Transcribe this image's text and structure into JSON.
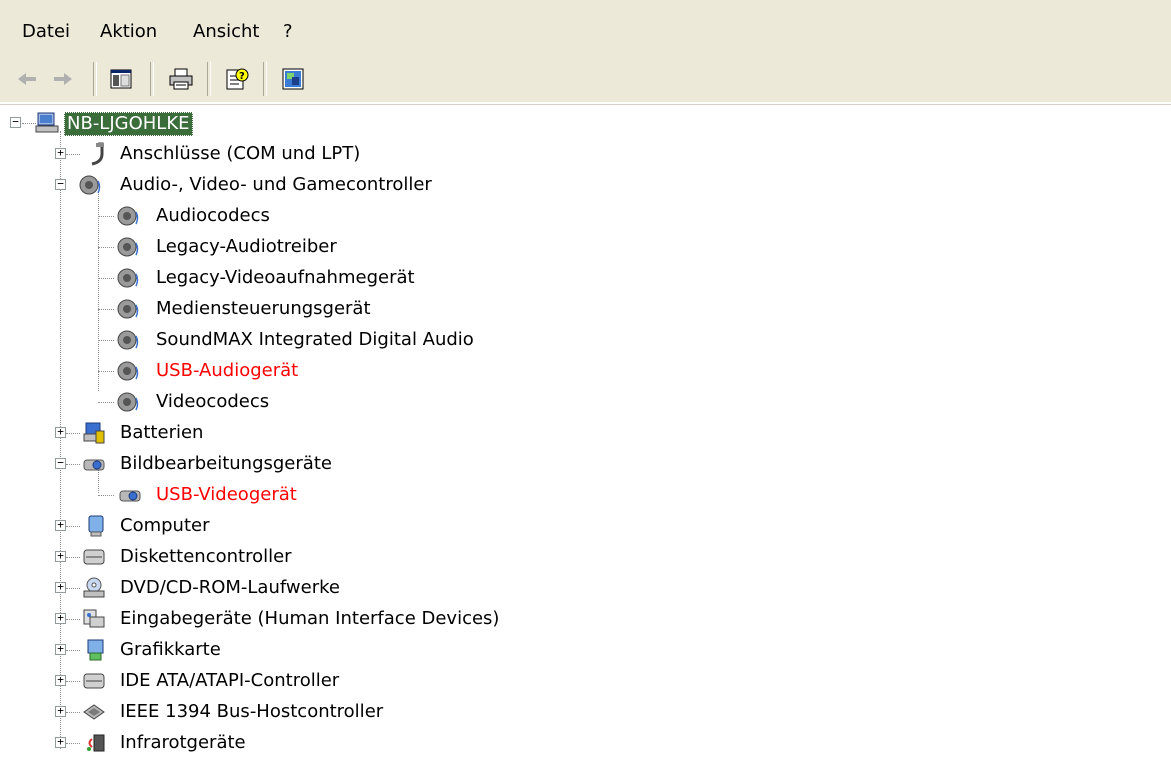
{
  "menu": {
    "items": [
      "Datei",
      "Aktion",
      "Ansicht",
      "?"
    ]
  },
  "toolbar": {
    "buttons": [
      "back-icon",
      "forward-icon",
      "show-hide-console-tree-icon",
      "print-icon",
      "help-icon",
      "properties-icon"
    ]
  },
  "tree": {
    "root": "NB-LJGOHLKE",
    "categories": {
      "ports": "Anschlüsse (COM und LPT)",
      "audio": "Audio-, Video- und Gamecontroller",
      "batteries": "Batterien",
      "imaging": "Bildbearbeitungsgeräte",
      "computer": "Computer",
      "floppy": "Diskettencontroller",
      "dvd": "DVD/CD-ROM-Laufwerke",
      "hid": "Eingabegeräte (Human Interface Devices)",
      "graphics": "Grafikkarte",
      "ide": "IDE ATA/ATAPI-Controller",
      "ieee1394": "IEEE 1394 Bus-Hostcontroller",
      "infrared": "Infrarotgeräte"
    },
    "audio_children": [
      "Audiocodecs",
      "Legacy-Audiotreiber",
      "Legacy-Videoaufnahmegerät",
      "Mediensteuerungsgerät",
      "SoundMAX Integrated Digital Audio",
      "USB-Audiogerät",
      "Videocodecs"
    ],
    "imaging_children": [
      "USB-Videogerät"
    ]
  },
  "colors": {
    "error_text": "#ff0000",
    "selection": "#3b6d3b",
    "chrome": "#ece9d8"
  }
}
